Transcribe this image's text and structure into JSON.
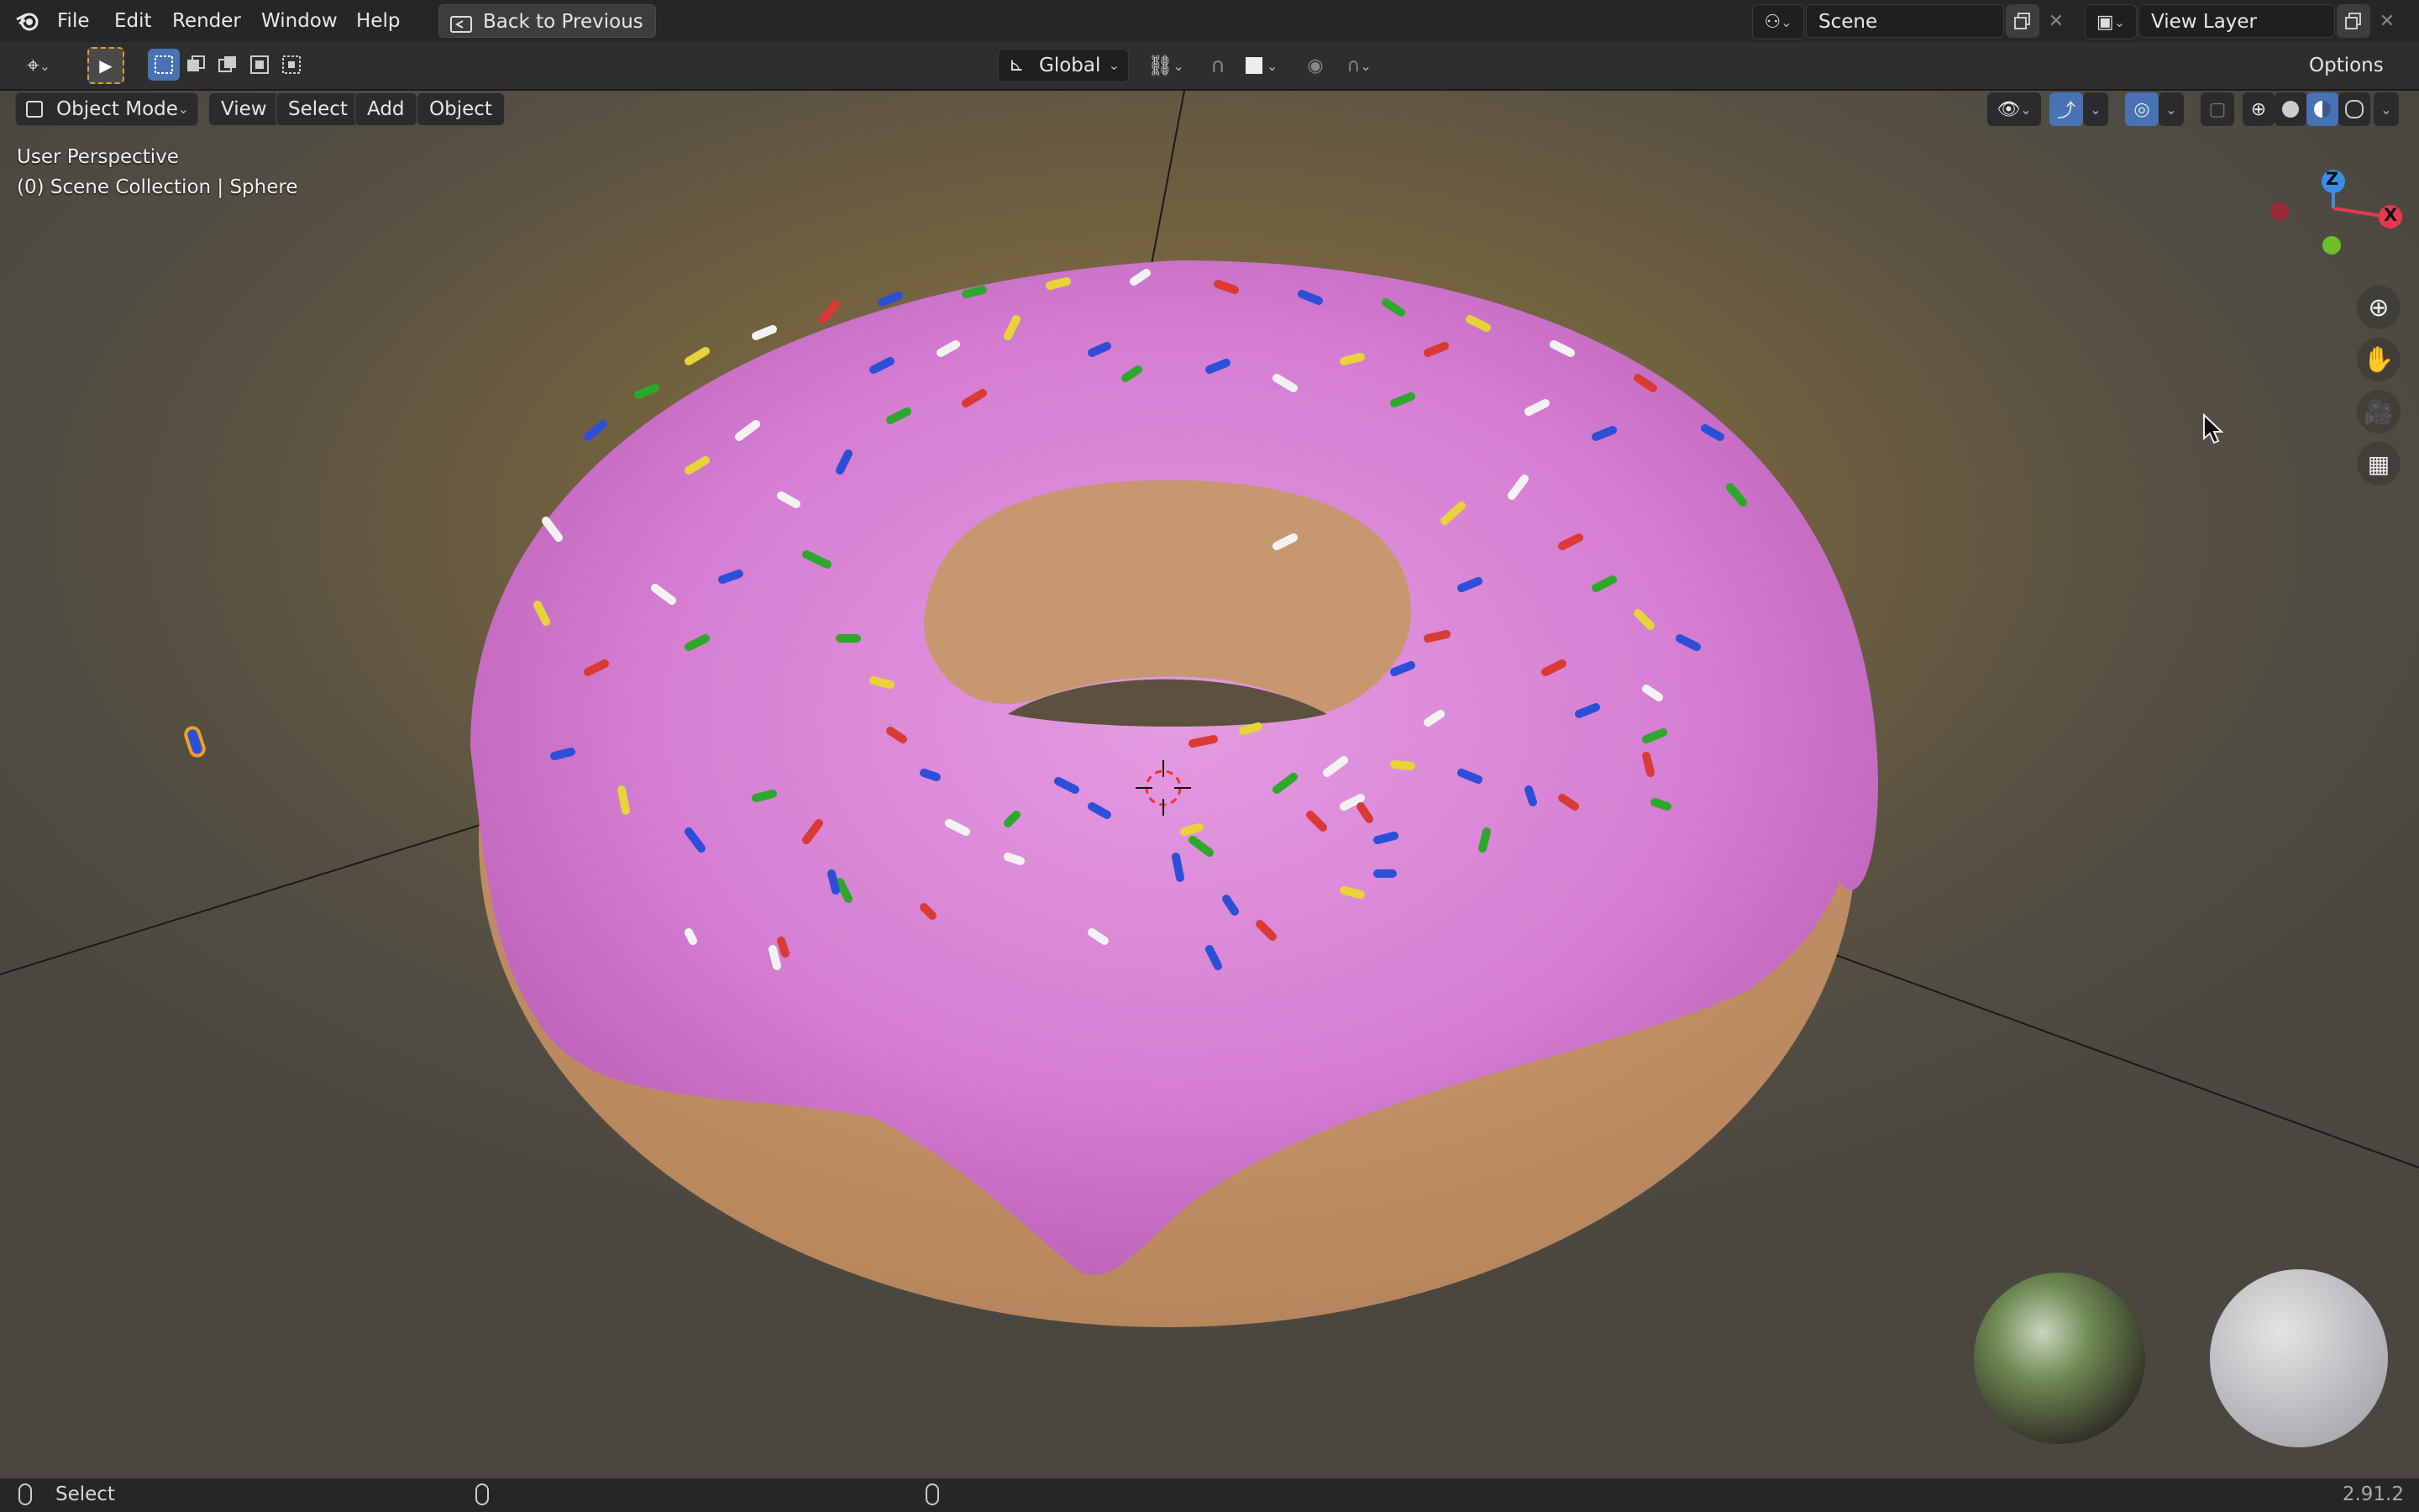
{
  "topbar": {
    "menus": [
      "File",
      "Edit",
      "Render",
      "Window",
      "Help"
    ],
    "back_button": "Back to Previous",
    "scene_name": "Scene",
    "view_layer_name": "View Layer"
  },
  "tool_header": {
    "orientation": "Global",
    "options": "Options"
  },
  "viewport_header": {
    "mode": "Object Mode",
    "menus": [
      "View",
      "Select",
      "Add",
      "Object"
    ]
  },
  "viewport": {
    "perspective": "User Perspective",
    "collection_info": "(0) Scene Collection | Sphere",
    "gizmo": {
      "z_label": "Z",
      "x_label": "X"
    }
  },
  "statusbar": {
    "left_hint": "Select",
    "version": "2.91.2"
  },
  "colors": {
    "frosting": "#d97fd6",
    "dough": "#c8966b",
    "x_axis": "#e8384f",
    "y_axis": "#6fbf2a",
    "z_axis": "#3a8ee6",
    "active_blue": "#4772b3"
  },
  "icons": [
    "blender-logo-icon",
    "editor-type-icon",
    "select-tool-icon",
    "back-icon",
    "scene-icon",
    "view-layer-icon",
    "zoom-icon",
    "pan-hand-icon",
    "camera-icon",
    "grid-ortho-icon",
    "mouse-icon",
    "light-object-icon"
  ]
}
